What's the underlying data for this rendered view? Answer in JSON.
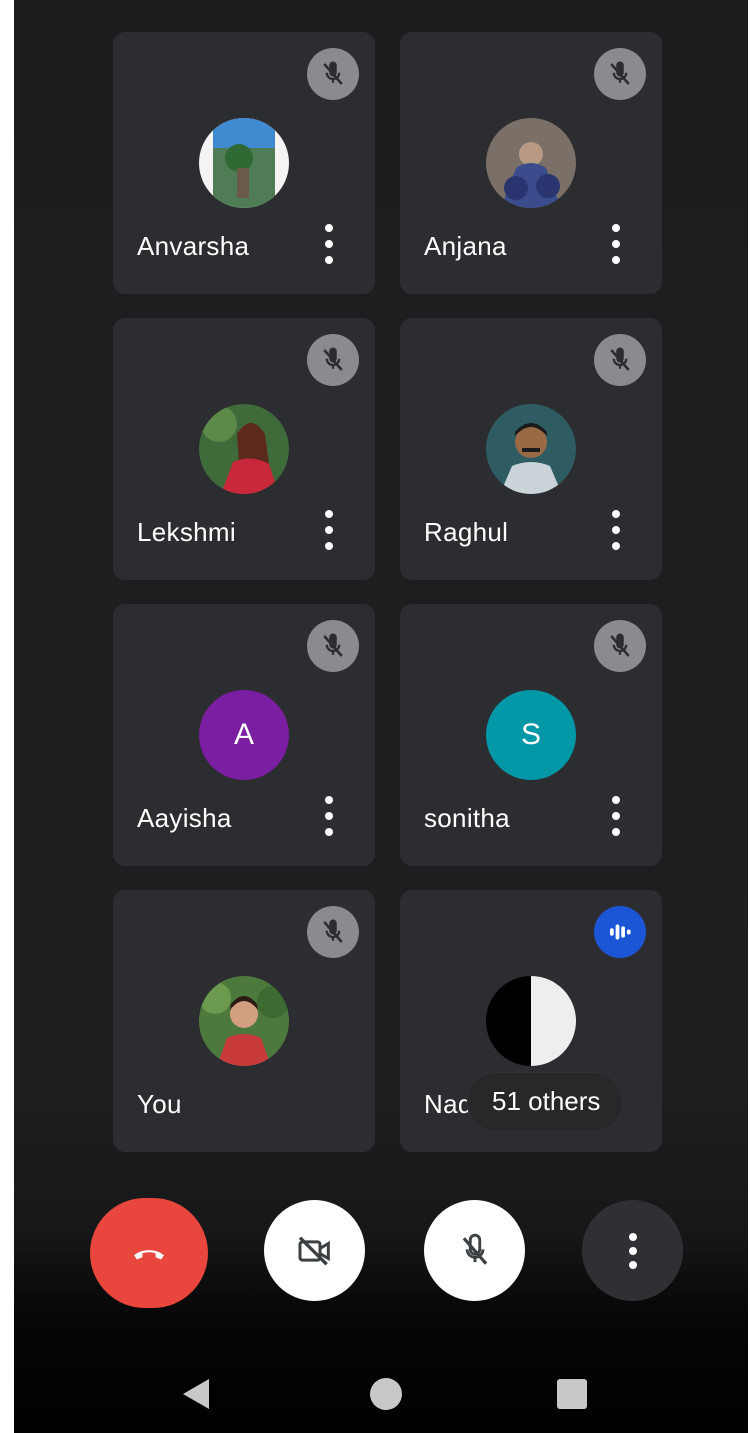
{
  "participants": [
    {
      "name": "Anvarsha",
      "avatar": "photo",
      "mic": "muted"
    },
    {
      "name": "Anjana",
      "avatar": "photo",
      "mic": "muted"
    },
    {
      "name": "Lekshmi",
      "avatar": "photo",
      "mic": "muted"
    },
    {
      "name": "Raghul",
      "avatar": "photo",
      "mic": "muted"
    },
    {
      "name": "Aayisha",
      "avatar": "initial",
      "initial": "A",
      "avatar_color": "#7b1fa2",
      "mic": "muted"
    },
    {
      "name": "sonitha",
      "avatar": "initial",
      "initial": "S",
      "avatar_color": "#0097a7",
      "mic": "muted"
    },
    {
      "name": "You",
      "avatar": "photo",
      "mic": "muted"
    },
    {
      "name": "Nad",
      "avatar": "half-circle",
      "mic": "speaking"
    }
  ],
  "others_chip": "51 others",
  "controls": {
    "end_call": "phone-hangup-icon",
    "camera": "camera-off-icon",
    "mic": "mic-off-icon",
    "more": "more-vert-icon"
  },
  "colors": {
    "end_call": "#e9463d",
    "speaking_badge": "#1a56d6",
    "tile_bg": "#2c2d30"
  },
  "nav": [
    "back-icon",
    "home-icon",
    "recents-icon"
  ]
}
